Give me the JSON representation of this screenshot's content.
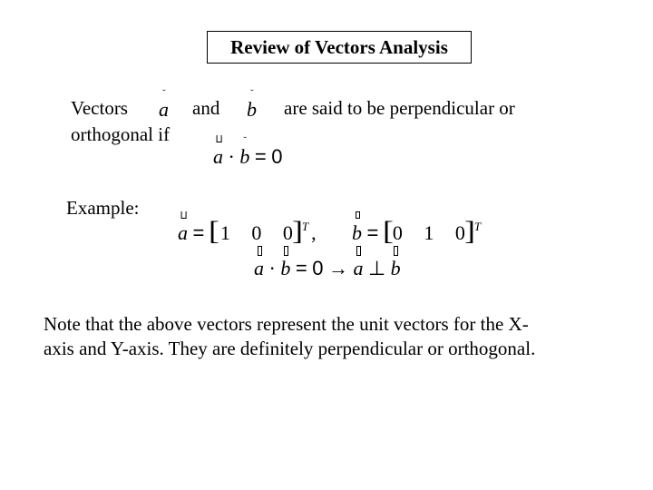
{
  "slide": {
    "title": "Review of Vectors Analysis",
    "intro": {
      "word_vectors": "Vectors",
      "symbol_a": "a",
      "word_and": "and",
      "symbol_b": "b",
      "rest_line1": "are said to be perpendicular or",
      "line2": "orthogonal if"
    },
    "condition": {
      "lhs_a": "a",
      "dot": "·",
      "lhs_b": "b",
      "equals": "=",
      "rhs": "0"
    },
    "example": {
      "label": "Example:",
      "vector_a": {
        "symbol": "a",
        "equals": "=",
        "open_bracket": "[",
        "components": [
          "1",
          "0",
          "0"
        ],
        "close_bracket": "]",
        "transpose": "T",
        "separator": ","
      },
      "vector_b": {
        "symbol": "b",
        "equals": "=",
        "open_bracket": "[",
        "components": [
          "0",
          "1",
          "0"
        ],
        "close_bracket": "]",
        "transpose": "T"
      },
      "result": {
        "a": "a",
        "dot": "·",
        "b": "b",
        "equals": "=",
        "zero": "0",
        "arrow": "→",
        "a2": "a",
        "perp": "⊥",
        "b2": "b"
      }
    },
    "note": {
      "line1": "Note that the above vectors represent the unit vectors for the X-",
      "line2": "axis and Y-axis. They are definitely perpendicular or orthogonal."
    }
  }
}
